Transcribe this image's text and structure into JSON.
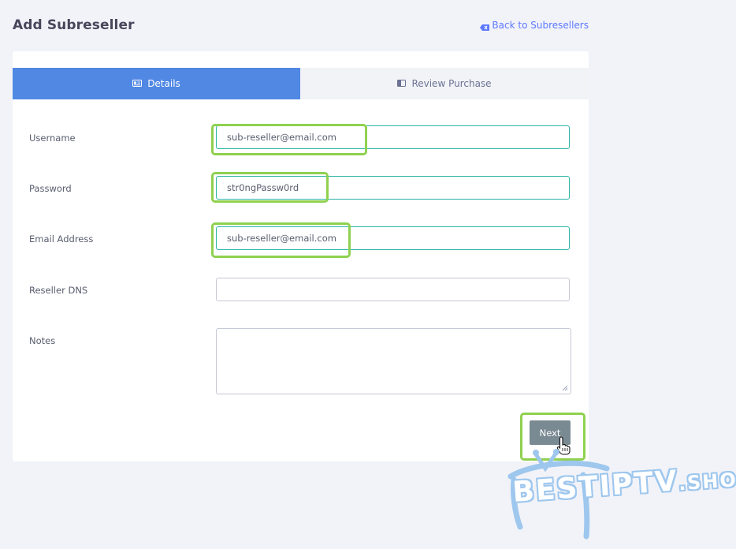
{
  "header": {
    "title": "Add Subreseller",
    "back_label": "Back to Subresellers"
  },
  "tabs": [
    {
      "label": "Details",
      "icon": "id-card-icon",
      "active": true
    },
    {
      "label": "Review Purchase",
      "icon": "panel-icon",
      "active": false
    }
  ],
  "form": {
    "username": {
      "label": "Username",
      "value": "sub-reseller@email.com"
    },
    "password": {
      "label": "Password",
      "value": "str0ngPassw0rd"
    },
    "email": {
      "label": "Email Address",
      "value": "sub-reseller@email.com"
    },
    "reseller_dns": {
      "label": "Reseller DNS",
      "value": ""
    },
    "notes": {
      "label": "Notes",
      "value": ""
    }
  },
  "actions": {
    "next_label": "Next"
  },
  "watermark": {
    "main": "BESTIPTV",
    "suffix": ".SHOP"
  },
  "colors": {
    "accent": "#5088e4",
    "field_border": "#2bb5a6",
    "highlight": "#8fd14f",
    "button": "#7a8a93",
    "link": "#5d78ff"
  }
}
